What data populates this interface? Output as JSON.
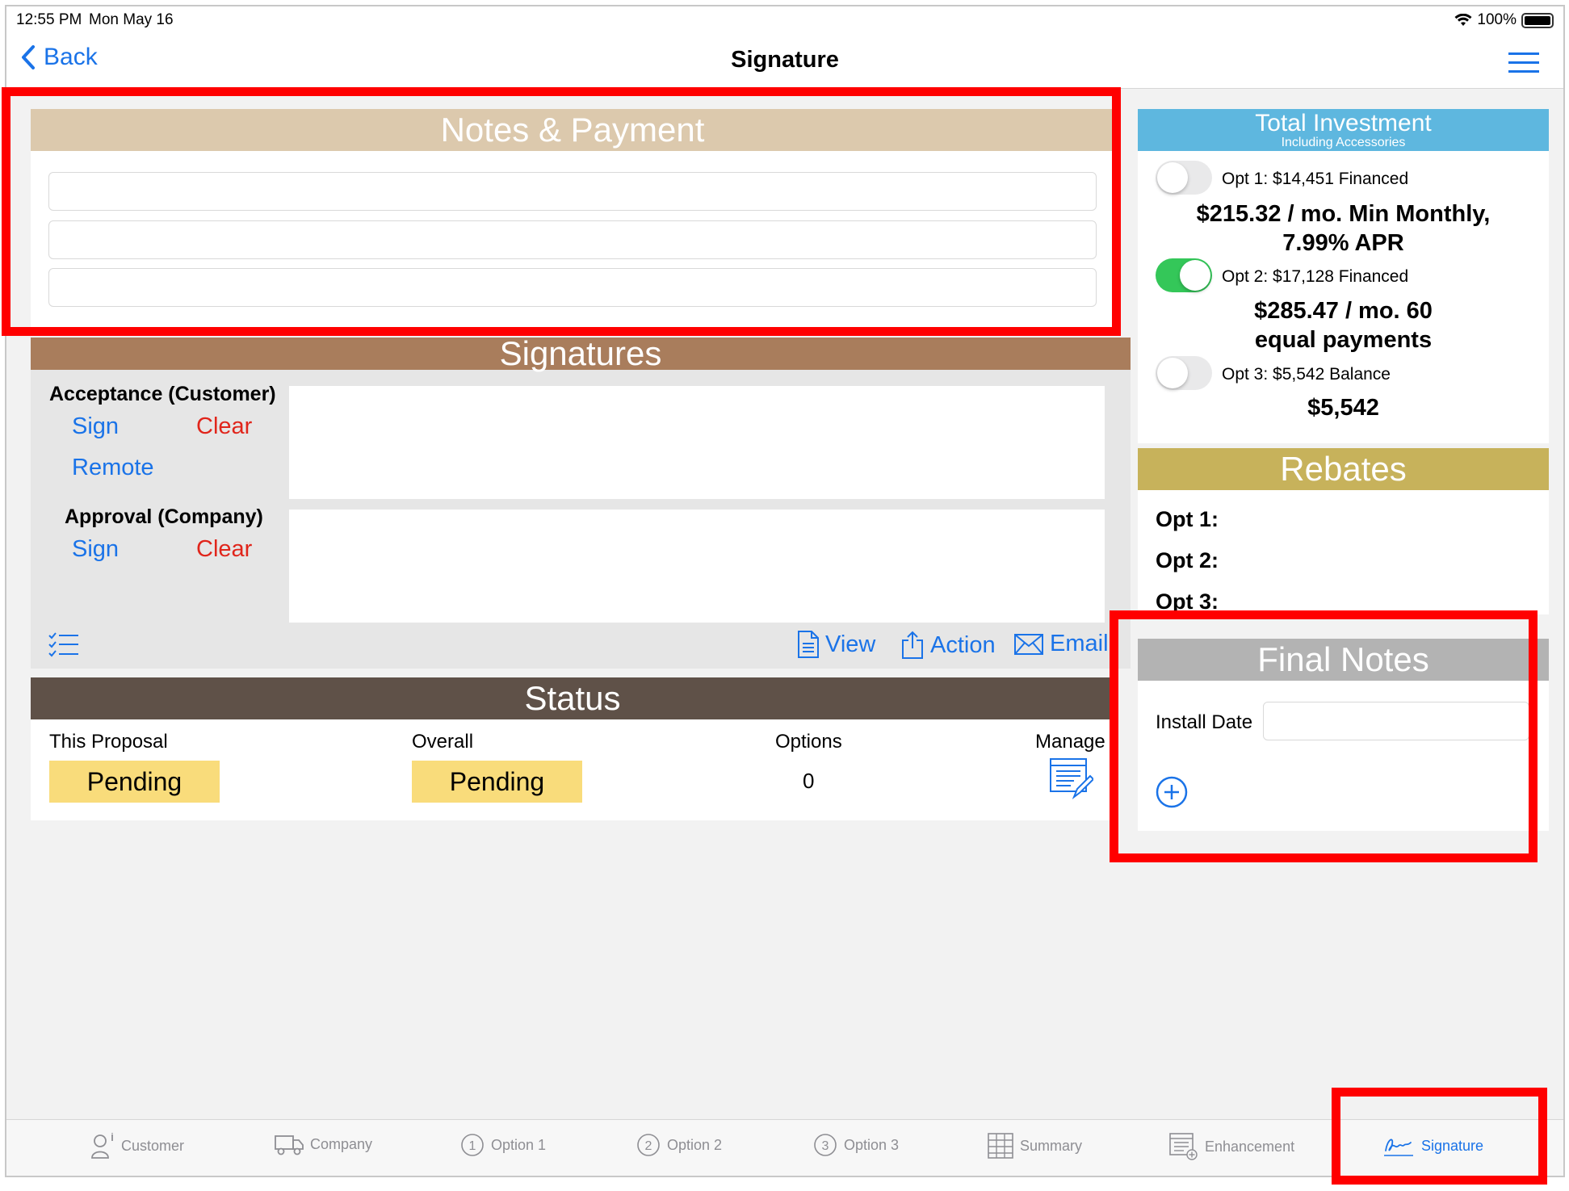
{
  "status_bar": {
    "time": "12:55 PM",
    "date": "Mon May 16",
    "battery": "100%"
  },
  "nav": {
    "back_label": "Back",
    "title": "Signature"
  },
  "notes_payment": {
    "header": "Notes & Payment"
  },
  "signatures": {
    "header": "Signatures",
    "acceptance_label": "Acceptance (Customer)",
    "approval_label": "Approval (Company)",
    "sign": "Sign",
    "clear": "Clear",
    "remote": "Remote",
    "view": "View",
    "action": "Action",
    "email": "Email"
  },
  "status": {
    "header": "Status",
    "this_proposal_label": "This Proposal",
    "overall_label": "Overall",
    "options_label": "Options",
    "manage_label": "Manage",
    "this_proposal_value": "Pending",
    "overall_value": "Pending",
    "options_value": "0"
  },
  "investment": {
    "title": "Total Investment",
    "subtitle": "Including Accessories",
    "options": [
      {
        "label": "Opt 1: $14,451 Financed",
        "amount_line1": "$215.32  / mo. Min Monthly,",
        "amount_line2": "7.99% APR",
        "on": false
      },
      {
        "label": "Opt 2: $17,128 Financed",
        "amount_line1": "$285.47  / mo. 60",
        "amount_line2": "equal payments",
        "on": true
      },
      {
        "label": "Opt 3: $5,542 Balance",
        "amount_line1": "$5,542",
        "amount_line2": "",
        "on": false
      }
    ]
  },
  "rebates": {
    "header": "Rebates",
    "items": [
      "Opt 1:",
      "Opt 2:",
      "Opt 3:"
    ]
  },
  "final_notes": {
    "header": "Final Notes",
    "install_date_label": "Install Date",
    "install_date_value": ""
  },
  "tabs": [
    {
      "label": "Customer",
      "icon": "person-icon",
      "active": false
    },
    {
      "label": "Company",
      "icon": "truck-icon",
      "active": false
    },
    {
      "label": "Option 1",
      "icon": "circle-1-icon",
      "active": false
    },
    {
      "label": "Option 2",
      "icon": "circle-2-icon",
      "active": false
    },
    {
      "label": "Option 3",
      "icon": "circle-3-icon",
      "active": false
    },
    {
      "label": "Summary",
      "icon": "summary-icon",
      "active": false
    },
    {
      "label": "Enhancement",
      "icon": "enhancement-icon",
      "active": false
    },
    {
      "label": "Signature",
      "icon": "signature-icon",
      "active": true
    }
  ],
  "colors": {
    "notes_header": "#dcc9ad",
    "signatures_header": "#a97d5c",
    "status_header": "#5f5148",
    "investment_header": "#5eb7df",
    "rebates_header": "#c7b25b",
    "final_notes_header": "#b3b3b3",
    "accent": "#1a73e8",
    "highlight": "#ff0000"
  }
}
